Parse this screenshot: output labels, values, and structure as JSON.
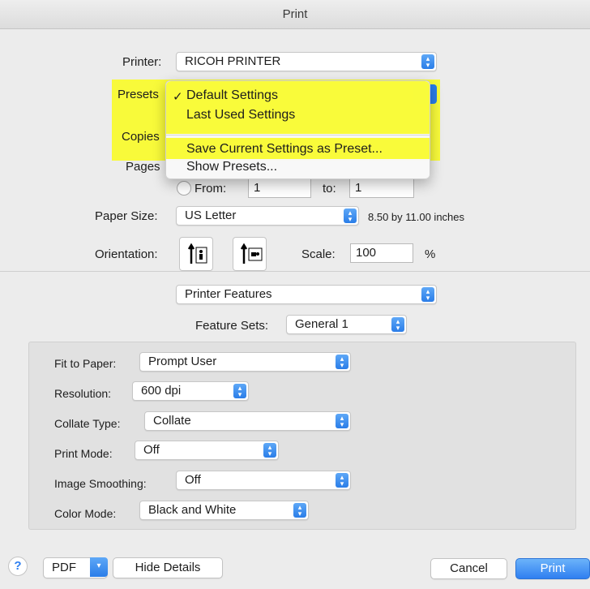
{
  "window": {
    "title": "Print"
  },
  "printer": {
    "label": "Printer:",
    "value": "RICOH PRINTER"
  },
  "presets": {
    "label": "Presets",
    "menu": {
      "items": [
        "Default Settings",
        "Last Used Settings",
        "Save Current Settings as Preset...",
        "Show Presets..."
      ],
      "checked": "✓"
    }
  },
  "copies": {
    "label": "Copies"
  },
  "pages": {
    "label": "Pages",
    "from_label": "From:",
    "from_value": "1",
    "to_label": "to:",
    "to_value": "1"
  },
  "paper_size": {
    "label": "Paper Size:",
    "value": "US Letter",
    "dimensions": "8.50 by 11.00 inches"
  },
  "orientation": {
    "label": "Orientation:"
  },
  "scale": {
    "label": "Scale:",
    "value": "100",
    "unit": "%"
  },
  "section": {
    "value": "Printer Features"
  },
  "feature_sets": {
    "label": "Feature Sets:",
    "value": "General 1"
  },
  "features": [
    {
      "label": "Fit to Paper:",
      "value": "Prompt User"
    },
    {
      "label": "Resolution:",
      "value": "600 dpi"
    },
    {
      "label": "Collate Type:",
      "value": "Collate"
    },
    {
      "label": "Print Mode:",
      "value": "Off"
    },
    {
      "label": "Image Smoothing:",
      "value": "Off"
    },
    {
      "label": "Color Mode:",
      "value": "Black and White"
    }
  ],
  "footer": {
    "help": "?",
    "pdf": "PDF",
    "hide_details": "Hide Details",
    "cancel": "Cancel",
    "print": "Print"
  },
  "colors": {
    "accent": "#2f7ff0",
    "highlight": "#f8fb2a"
  }
}
